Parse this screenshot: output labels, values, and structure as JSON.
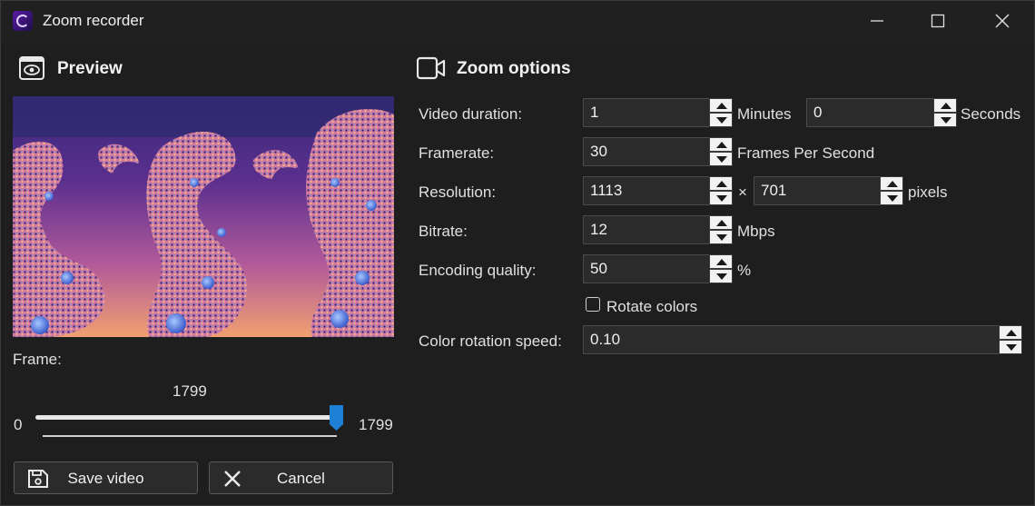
{
  "window": {
    "title": "Zoom recorder"
  },
  "preview": {
    "heading": "Preview",
    "frame_label": "Frame:"
  },
  "slider": {
    "current": "1799",
    "min": "0",
    "max": "1799",
    "value": 1799,
    "max_value": 1799
  },
  "buttons": {
    "save": "Save video",
    "cancel": "Cancel"
  },
  "options": {
    "heading": "Zoom options",
    "duration": {
      "label": "Video duration:",
      "minutes": "1",
      "minutes_unit": "Minutes",
      "seconds": "0",
      "seconds_unit": "Seconds"
    },
    "framerate": {
      "label": "Framerate:",
      "value": "30",
      "unit": "Frames Per Second"
    },
    "resolution": {
      "label": "Resolution:",
      "width": "1113",
      "sep": "×",
      "height": "701",
      "unit": "pixels"
    },
    "bitrate": {
      "label": "Bitrate:",
      "value": "12",
      "unit": "Mbps"
    },
    "quality": {
      "label": "Encoding quality:",
      "value": "50",
      "unit": "%"
    },
    "rotate": {
      "label": "Rotate colors",
      "checked": false
    },
    "rotation_speed": {
      "label": "Color rotation speed:",
      "value": "0.10"
    }
  },
  "icons": {
    "app": "fractal-app-icon",
    "preview": "eye-icon",
    "options": "video-camera-icon",
    "save": "floppy-disk-icon",
    "cancel": "close-icon"
  },
  "colors": {
    "background": "#1e1e1e",
    "accent": "#1e7fd6"
  }
}
